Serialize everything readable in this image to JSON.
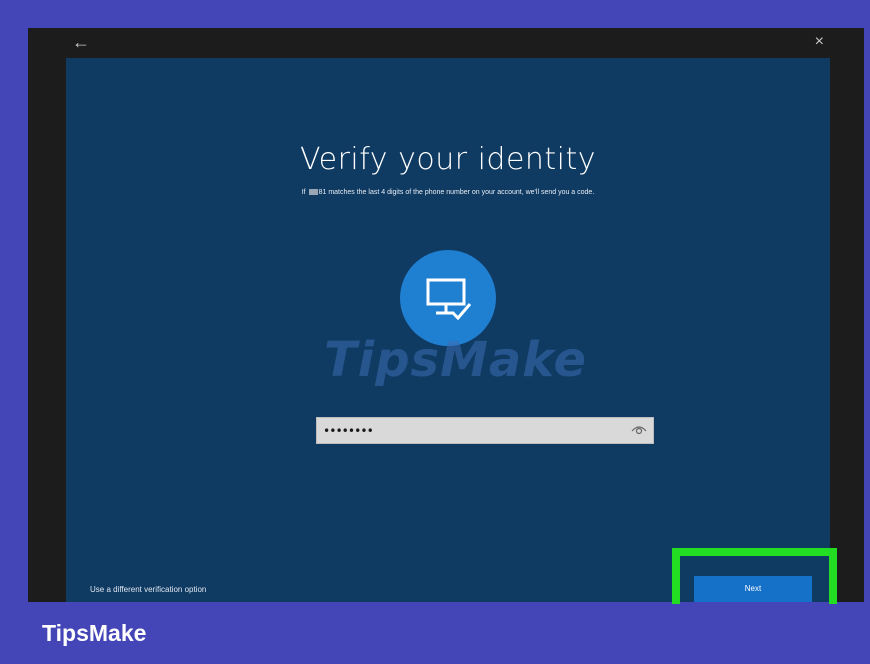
{
  "window": {
    "back_glyph": "←",
    "close_glyph": "×"
  },
  "dialog": {
    "title": "Verify your identity",
    "subtitle_before": "If ",
    "subtitle_digits": "81",
    "subtitle_after": " matches the last 4 digits of the phone number on your account, we'll send you a code.",
    "avatar_icon": "monitor-check-icon",
    "password_value": "••••••••",
    "eye_icon": "eye-icon",
    "alt_option_link": "Use a different verification option",
    "next_button": "Next"
  },
  "watermark": "TipsMake",
  "brand": "TipsMake",
  "colors": {
    "outer_background": "#4446b8",
    "panel": "#0f3a62",
    "accent": "#1f7fd1",
    "next_button": "#1570c8",
    "highlight": "#22dd22"
  }
}
